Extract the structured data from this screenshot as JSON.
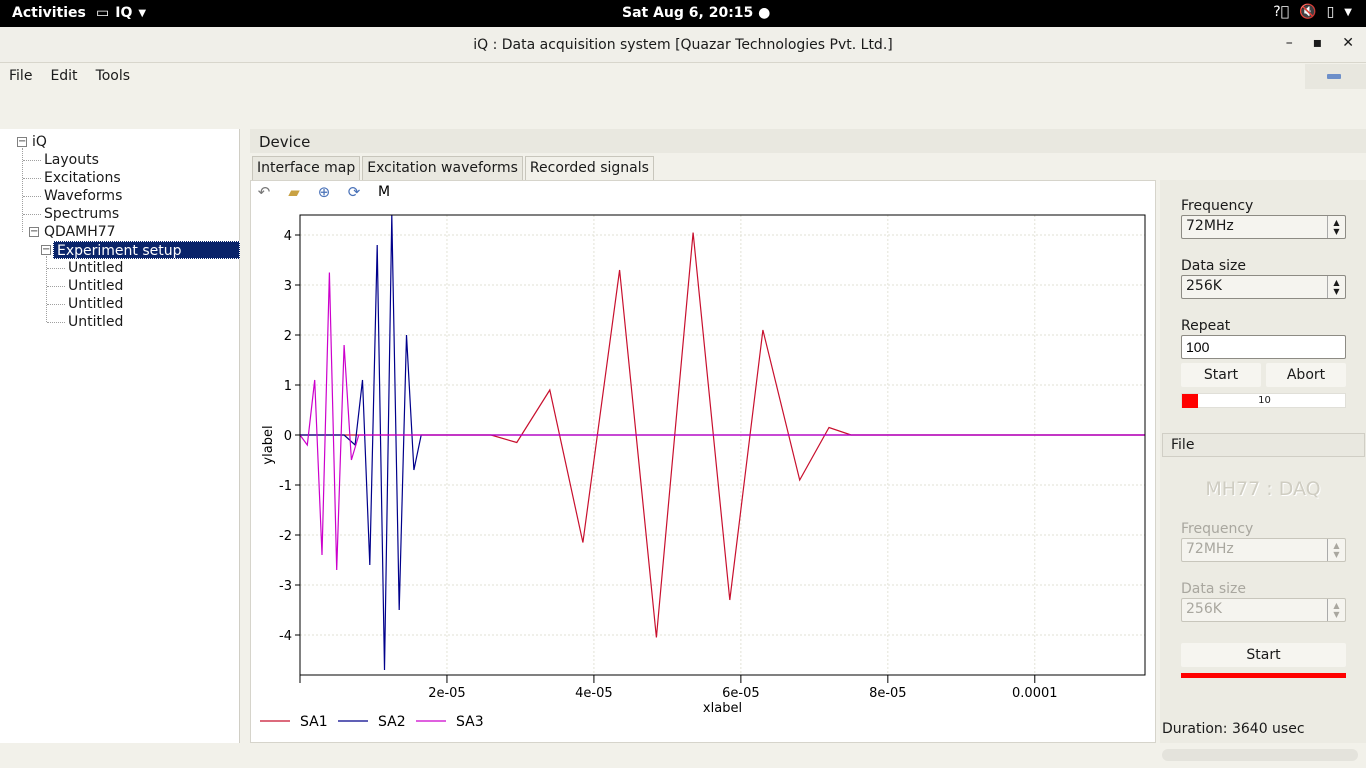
{
  "topbar": {
    "activities": "Activities",
    "app_name": "IQ",
    "clock": "Sat Aug  6, 20:15",
    "tray_icons": [
      "help-icon",
      "volume-icon",
      "battery-icon",
      "menu-arrow-icon"
    ]
  },
  "window": {
    "title": "iQ : Data acquisition system  [Quazar Technologies Pvt. Ltd.]",
    "minimize": "–",
    "maximize": "▪",
    "close": "✕"
  },
  "menu": {
    "file": "File",
    "edit": "Edit",
    "tools": "Tools"
  },
  "tree": {
    "root": "iQ",
    "items": [
      "Layouts",
      "Excitations",
      "Waveforms",
      "Spectrums"
    ],
    "device": "QDAMH77",
    "selected": "Experiment setup",
    "children": [
      "Untitled",
      "Untitled",
      "Untitled",
      "Untitled"
    ]
  },
  "device_header": "Device",
  "tabs": [
    "Interface map",
    "Excitation waveforms",
    "Recorded signals"
  ],
  "plot_toolbar": {
    "icons": [
      "undo-icon",
      "open-folder-icon",
      "zoom-icon",
      "refresh-icon"
    ],
    "m_label": "M"
  },
  "chart_data": {
    "type": "line",
    "xlabel": "xlabel",
    "ylabel": "ylabel",
    "xlim": [
      0,
      0.000115
    ],
    "ylim": [
      -4.8,
      4.4
    ],
    "x_ticks": [
      {
        "v": 2e-05,
        "label": "2e-05"
      },
      {
        "v": 4e-05,
        "label": "4e-05"
      },
      {
        "v": 6e-05,
        "label": "6e-05"
      },
      {
        "v": 8e-05,
        "label": "8e-05"
      },
      {
        "v": 0.0001,
        "label": "0.0001"
      }
    ],
    "y_ticks": [
      4,
      3,
      2,
      1,
      0,
      -1,
      -2,
      -3,
      -4
    ],
    "grid": true,
    "legend_position": "bottom-left",
    "series": [
      {
        "name": "SA1",
        "color": "#c8102e",
        "x": [
          0,
          2.6e-05,
          2.95e-05,
          3.4e-05,
          3.85e-05,
          4.35e-05,
          4.85e-05,
          5.35e-05,
          5.85e-05,
          6.3e-05,
          6.8e-05,
          7.2e-05,
          7.5e-05,
          0.000115
        ],
        "y": [
          0,
          0,
          -0.15,
          0.9,
          -2.15,
          3.3,
          -4.05,
          4.05,
          -3.3,
          2.1,
          -0.9,
          0.15,
          0,
          0
        ]
      },
      {
        "name": "SA2",
        "color": "#00008b",
        "x": [
          0,
          6e-06,
          7.5e-06,
          8.5e-06,
          9.5e-06,
          1.05e-05,
          1.15e-05,
          1.25e-05,
          1.35e-05,
          1.45e-05,
          1.55e-05,
          1.65e-05,
          0.000115
        ],
        "y": [
          0,
          0,
          -0.2,
          1.1,
          -2.6,
          3.8,
          -4.7,
          4.4,
          -3.5,
          2.0,
          -0.7,
          0,
          0
        ]
      },
      {
        "name": "SA3",
        "color": "#cc00cc",
        "x": [
          0,
          1e-06,
          2e-06,
          3e-06,
          4e-06,
          5e-06,
          6e-06,
          7e-06,
          8e-06,
          0.000115
        ],
        "y": [
          0,
          -0.2,
          1.1,
          -2.4,
          3.25,
          -2.7,
          1.8,
          -0.5,
          0,
          0
        ]
      }
    ]
  },
  "right_panel": {
    "frequency_label": "Frequency",
    "frequency_value": "72MHz",
    "data_size_label": "Data size",
    "data_size_value": "256K",
    "repeat_label": "Repeat",
    "repeat_value": "100",
    "start": "Start",
    "abort": "Abort",
    "progress": 10,
    "progress_fraction": 0.1,
    "file_header": "File",
    "logo": "MH77 : DAQ",
    "frequency2_label": "Frequency",
    "frequency2_value": "72MHz",
    "data_size2_label": "Data size",
    "data_size2_value": "256K",
    "start2": "Start",
    "duration": "Duration: 3640 usec"
  }
}
